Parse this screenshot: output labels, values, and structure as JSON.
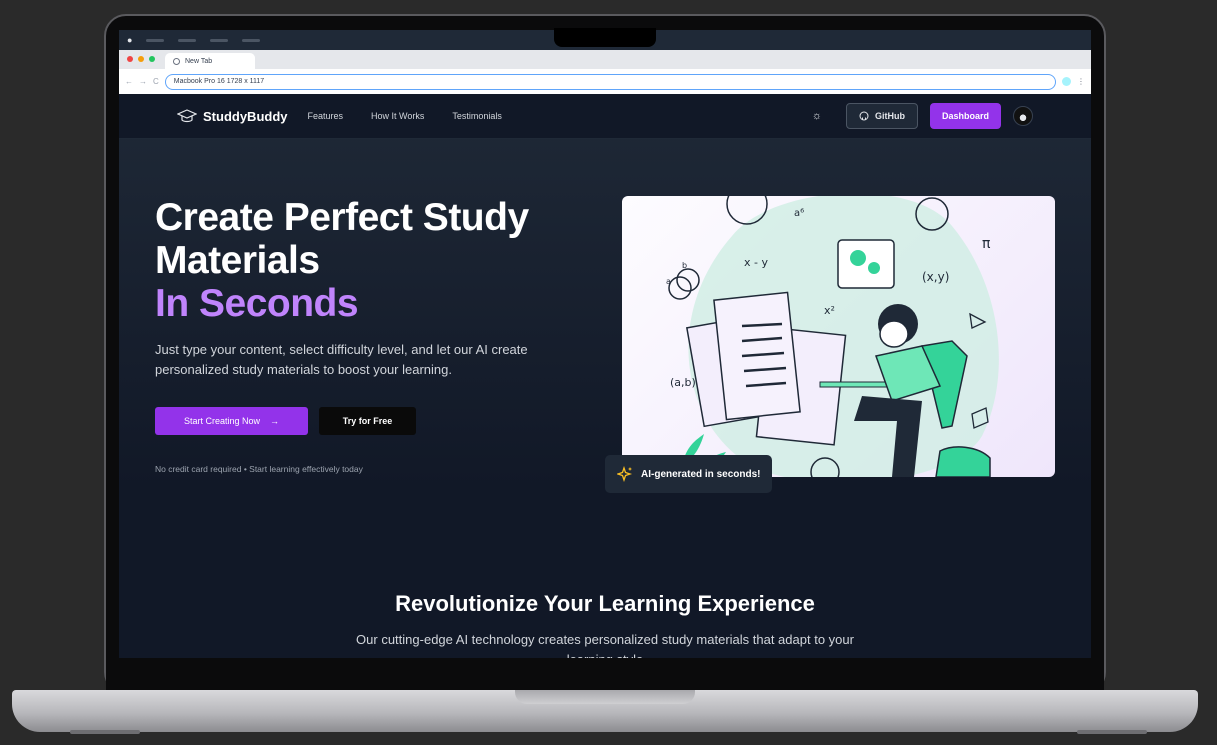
{
  "browser": {
    "tab_title": "New Tab",
    "url": "Macbook Pro 16   1728 x 1117"
  },
  "nav": {
    "brand": "StuddyBuddy",
    "links": [
      "Features",
      "How It Works",
      "Testimonials"
    ],
    "github_label": "GitHub",
    "dashboard_label": "Dashboard"
  },
  "hero": {
    "title_line1": "Create Perfect Study",
    "title_line2": "Materials",
    "title_accent": "In Seconds",
    "subtitle": "Just type your content, select difficulty level, and let our AI create personalized study materials to boost your learning.",
    "primary_cta": "Start Creating Now",
    "secondary_cta": "Try for Free",
    "note": "No credit card required • Start learning effectively today",
    "badge": "AI-generated in seconds!"
  },
  "section": {
    "title": "Revolutionize Your Learning Experience",
    "subtitle": "Our cutting-edge AI technology creates personalized study materials that adapt to your learning style"
  },
  "illustration_labels": {
    "a6": "a⁶",
    "xy": "x - y",
    "x2": "x²",
    "pair": "(x,y)",
    "ab": "(a,b)",
    "pi": "π",
    "a": "a",
    "b": "b"
  },
  "colors": {
    "accent": "#9333ea",
    "accent_text": "#c084fc",
    "background": "#111827"
  }
}
